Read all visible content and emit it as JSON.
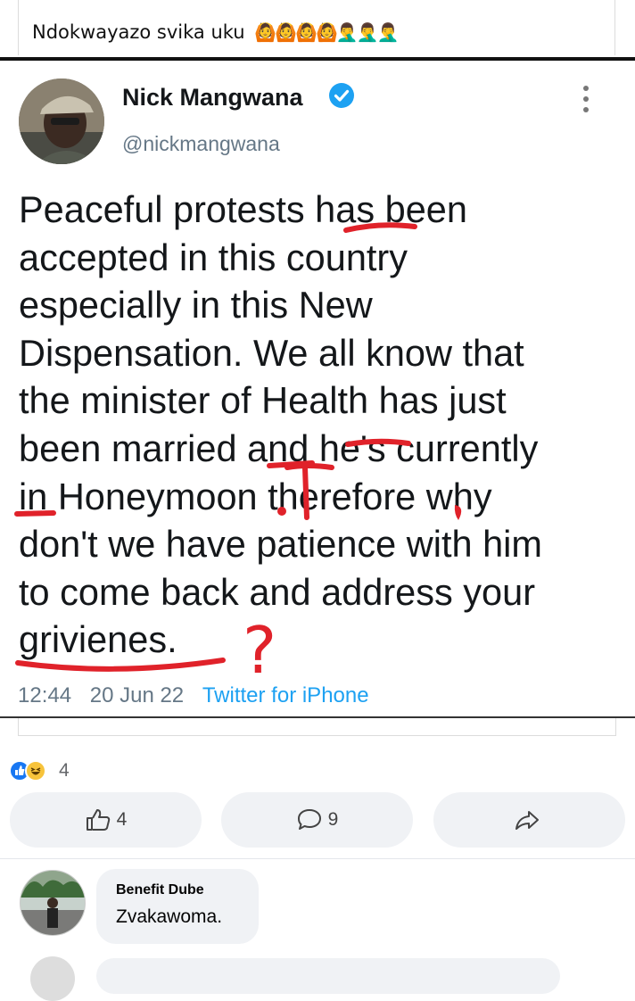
{
  "post": {
    "caption_text": "Ndokwayazo svika uku",
    "caption_emoji": "🙆🙆🙆🙆🤦‍♂️🤦‍♂️🤦‍♂️"
  },
  "tweet": {
    "author_name": "Nick Mangwana",
    "handle": "@nickmangwana",
    "verified": true,
    "lines": [
      "Peaceful protests has been",
      "accepted in this country",
      "especially in this New",
      "Dispensation. We all know that",
      "the minister of Health has just",
      "been married and he's currently",
      "in Honeymoon therefore why",
      "don't we have patience with him",
      "to come back and address your",
      "grivienes."
    ],
    "time": "12:44",
    "date": "20 Jun 22",
    "source": "Twitter for iPhone",
    "annotation_color": "#e0222a",
    "annotation_question_mark": "?"
  },
  "reactions": {
    "count": "4",
    "icons": [
      "like-icon",
      "haha-icon"
    ]
  },
  "actions": {
    "like_count": "4",
    "comment_count": "9",
    "share_label": ""
  },
  "comments": [
    {
      "author": "Benefit Dube",
      "text": "Zvakawoma."
    }
  ],
  "colors": {
    "facebook_blue": "#1877f2",
    "twitter_blue": "#1da1f2",
    "button_bg": "#f0f2f5"
  }
}
